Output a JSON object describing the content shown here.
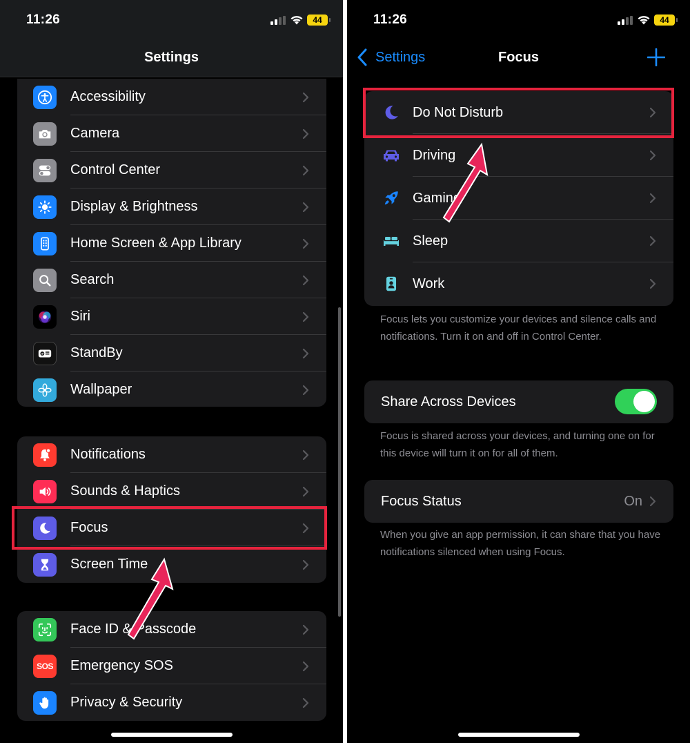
{
  "status_bar": {
    "time": "11:26",
    "battery": "44"
  },
  "settings_screen": {
    "title": "Settings",
    "group1": [
      {
        "label": "Accessibility",
        "icon": "accessibility-icon",
        "color": "#1a84ff"
      },
      {
        "label": "Camera",
        "icon": "camera-icon",
        "color": "#8e8e93"
      },
      {
        "label": "Control Center",
        "icon": "toggles-icon",
        "color": "#8e8e93"
      },
      {
        "label": "Display & Brightness",
        "icon": "sun-icon",
        "color": "#1a84ff"
      },
      {
        "label": "Home Screen & App Library",
        "icon": "phone-grid-icon",
        "color": "#1a84ff"
      },
      {
        "label": "Search",
        "icon": "magnifier-icon",
        "color": "#8e8e93"
      },
      {
        "label": "Siri",
        "icon": "siri-icon",
        "color": "#000000"
      },
      {
        "label": "StandBy",
        "icon": "standby-icon",
        "color": "#111111"
      },
      {
        "label": "Wallpaper",
        "icon": "flower-icon",
        "color": "#33aadc"
      }
    ],
    "group2": [
      {
        "label": "Notifications",
        "icon": "bell-icon",
        "color": "#ff3b30"
      },
      {
        "label": "Sounds & Haptics",
        "icon": "speaker-icon",
        "color": "#ff2d55"
      },
      {
        "label": "Focus",
        "icon": "moon-icon",
        "color": "#5e5ce6"
      },
      {
        "label": "Screen Time",
        "icon": "hourglass-icon",
        "color": "#5e5ce6"
      }
    ],
    "group3": [
      {
        "label": "Face ID & Passcode",
        "icon": "face-id-icon",
        "color": "#34c759"
      },
      {
        "label": "Emergency SOS",
        "icon": "sos-icon",
        "color": "#ff3b30",
        "badge": "SOS"
      },
      {
        "label": "Privacy & Security",
        "icon": "hand-icon",
        "color": "#1a84ff"
      }
    ]
  },
  "focus_screen": {
    "back_label": "Settings",
    "title": "Focus",
    "modes": [
      {
        "label": "Do Not Disturb",
        "icon": "moon-icon",
        "color": "#5e5ce6"
      },
      {
        "label": "Driving",
        "icon": "car-icon",
        "color": "#5e5ce6"
      },
      {
        "label": "Gaming",
        "icon": "rocket-icon",
        "color": "#1a84ff"
      },
      {
        "label": "Sleep",
        "icon": "bed-icon",
        "color": "#64d2e0"
      },
      {
        "label": "Work",
        "icon": "badge-icon",
        "color": "#64d2e0"
      }
    ],
    "modes_footnote": "Focus lets you customize your devices and silence calls and notifications. Turn it on and off in Control Center.",
    "share_label": "Share Across Devices",
    "share_enabled": true,
    "share_footnote": "Focus is shared across your devices, and turning one on for this device will turn it on for all of them.",
    "status_label": "Focus Status",
    "status_value": "On",
    "status_footnote": "When you give an app permission, it can share that you have notifications silenced when using Focus."
  },
  "annotation_color": "#e5233d",
  "accent_color": "#1a8cff"
}
